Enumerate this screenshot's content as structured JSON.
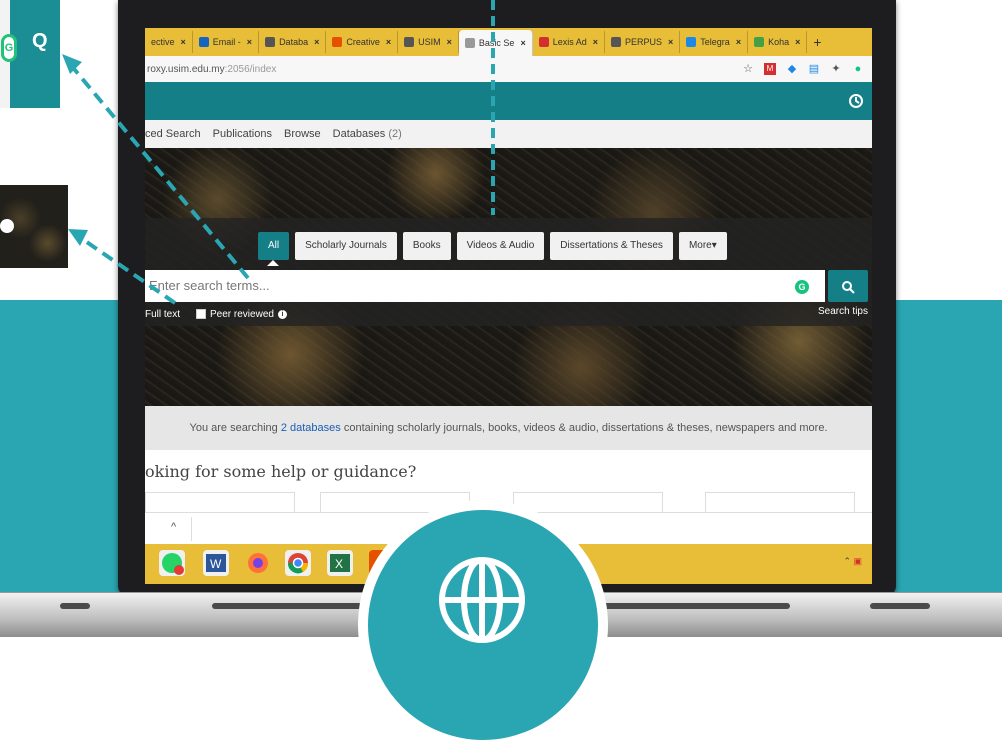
{
  "browser": {
    "tabs": [
      {
        "label": "ective",
        "color": "#888"
      },
      {
        "label": "Email -",
        "color": "#1565c0"
      },
      {
        "label": "Databa",
        "color": "#555"
      },
      {
        "label": "Creative",
        "color": "#e65100"
      },
      {
        "label": "USIM",
        "color": "#555"
      },
      {
        "label": "Basic Se",
        "color": "#999"
      },
      {
        "label": "Lexis Ad",
        "color": "#d32f2f"
      },
      {
        "label": "PERPUS",
        "color": "#555"
      },
      {
        "label": "Telegra",
        "color": "#1e88e5"
      },
      {
        "label": "Koha",
        "color": "#43a047"
      }
    ],
    "tab_close": "×",
    "new_tab": "+",
    "url_host": "roxy.usim.edu.my",
    "url_rest": ":2056/index"
  },
  "nav": {
    "items": [
      "ced Search",
      "Publications",
      "Browse"
    ],
    "databases_label": "Databases",
    "databases_count": "(2)"
  },
  "search": {
    "content_types": [
      "All",
      "Scholarly Journals",
      "Books",
      "Videos & Audio",
      "Dissertations & Theses",
      "More▾"
    ],
    "placeholder": "Enter search terms...",
    "button_icon": "search-icon",
    "full_text_label": "Full text",
    "peer_reviewed_label": "Peer reviewed",
    "tips_label": "Search tips"
  },
  "notice": {
    "prefix": "You are searching",
    "link": "2 databases",
    "suffix": "containing scholarly journals, books, videos & audio, dissertations & theses, newspapers and more."
  },
  "help": {
    "title": "oking for some help or guidance?"
  },
  "downloads": {
    "chevron": "^"
  },
  "insets": {
    "q_glyph": "Q",
    "g_glyph": "G"
  },
  "colors": {
    "accent": "#157f87",
    "teal_band": "#2aa6b2",
    "tab_strip": "#e8bd38"
  }
}
